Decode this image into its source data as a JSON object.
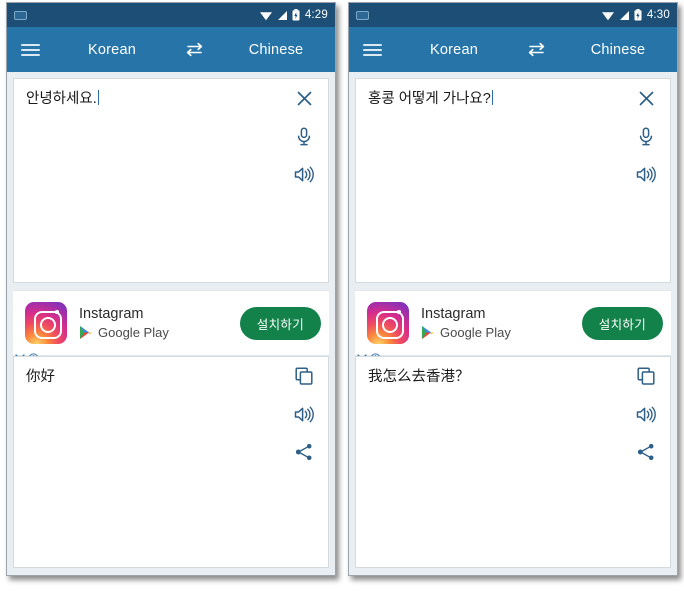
{
  "theme": {
    "statusbar_color": "#1d4f76",
    "appbar_color": "#2674a8",
    "page_bg": "#e9eef3",
    "card_bg": "#ffffff",
    "icon_color": "#2d5f88",
    "install_button_color": "#12824a",
    "text_color": "#1a1a1a"
  },
  "panels": [
    {
      "statusbar": {
        "capture_icon": "screenshot-icon",
        "wifi_icon": "wifi-icon",
        "signal_icon": "signal-icon",
        "battery_icon": "battery-icon",
        "clock": "4:29"
      },
      "appbar": {
        "menu_icon": "hamburger-menu-icon",
        "source_language": "Korean",
        "swap_icon": "swap-languages-icon",
        "target_language": "Chinese"
      },
      "input_card": {
        "text": "안녕하세요.",
        "clear_icon": "close-icon",
        "mic_icon": "microphone-icon",
        "speak_icon": "speaker-icon"
      },
      "ad": {
        "app_name": "Instagram",
        "store": "Google Play",
        "install_label": "설치하기",
        "logo_icon": "instagram-icon",
        "store_icon": "google-play-icon",
        "dismiss_icon": "ad-close-icon",
        "info_icon": "ad-info-icon"
      },
      "output_card": {
        "text": "你好",
        "copy_icon": "copy-icon",
        "speak_icon": "speaker-icon",
        "share_icon": "share-icon"
      }
    },
    {
      "statusbar": {
        "capture_icon": "screenshot-icon",
        "wifi_icon": "wifi-icon",
        "signal_icon": "signal-icon",
        "battery_icon": "battery-icon",
        "clock": "4:30"
      },
      "appbar": {
        "menu_icon": "hamburger-menu-icon",
        "source_language": "Korean",
        "swap_icon": "swap-languages-icon",
        "target_language": "Chinese"
      },
      "input_card": {
        "text": "홍콩 어떻게 가나요?",
        "clear_icon": "close-icon",
        "mic_icon": "microphone-icon",
        "speak_icon": "speaker-icon"
      },
      "ad": {
        "app_name": "Instagram",
        "store": "Google Play",
        "install_label": "설치하기",
        "logo_icon": "instagram-icon",
        "store_icon": "google-play-icon",
        "dismiss_icon": "ad-close-icon",
        "info_icon": "ad-info-icon"
      },
      "output_card": {
        "text": "我怎么去香港？",
        "copy_icon": "copy-icon",
        "speak_icon": "speaker-icon",
        "share_icon": "share-icon"
      }
    }
  ]
}
